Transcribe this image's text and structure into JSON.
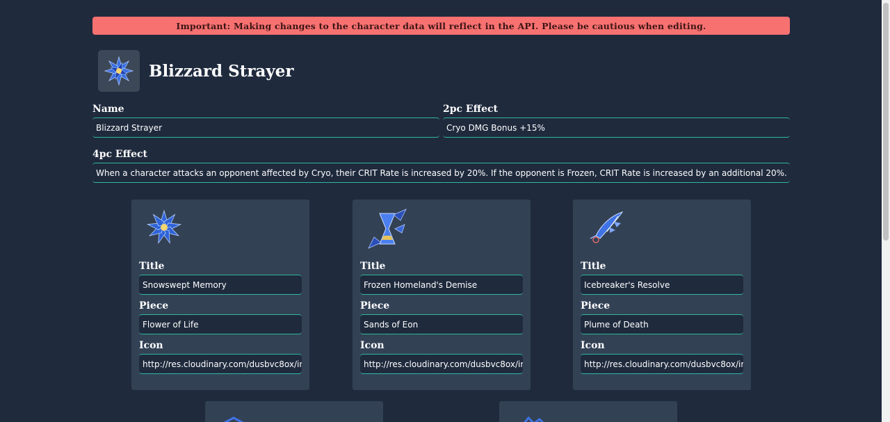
{
  "banner": {
    "text": "Important: Making changes to the character data will reflect in the API. Please be cautious when editing."
  },
  "set": {
    "name": "Blizzard Strayer",
    "icon": "blue-flower-icon",
    "fields": {
      "name_label": "Name",
      "name_value": "Blizzard Strayer",
      "two_pc_label": "2pc Effect",
      "two_pc_value": "Cryo DMG Bonus +15%",
      "four_pc_label": "4pc Effect",
      "four_pc_value": "When a character attacks an opponent affected by Cryo, their CRIT Rate is increased by 20%. If the opponent is Frozen, CRIT Rate is increased by an additional 20%."
    }
  },
  "pieces": [
    {
      "icon": "flower-of-life-icon",
      "title_label": "Title",
      "title": "Snowswept Memory",
      "piece_label": "Piece",
      "piece": "Flower of Life",
      "icon_label": "Icon",
      "icon_url": "http://res.cloudinary.com/dusbvc8ox/ima"
    },
    {
      "icon": "sands-of-eon-icon",
      "title_label": "Title",
      "title": "Frozen Homeland's Demise",
      "piece_label": "Piece",
      "piece": "Sands of Eon",
      "icon_label": "Icon",
      "icon_url": "http://res.cloudinary.com/dusbvc8ox/ima"
    },
    {
      "icon": "plume-of-death-icon",
      "title_label": "Title",
      "title": "Icebreaker's Resolve",
      "piece_label": "Piece",
      "piece": "Plume of Death",
      "icon_label": "Icon",
      "icon_url": "http://res.cloudinary.com/dusbvc8ox/ima"
    }
  ],
  "colors": {
    "background": "#1f2a3d",
    "card": "#334155",
    "banner": "#f87171",
    "accent": "#2fb8a2"
  }
}
